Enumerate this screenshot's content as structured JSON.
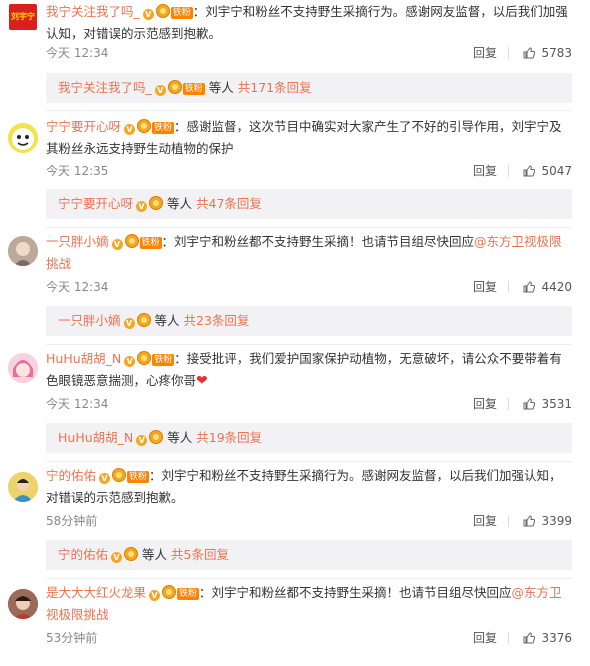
{
  "comments": [
    {
      "username": "我宁关注我了吗_",
      "fan_badge": "铁粉",
      "text": "：刘宇宁和粉丝不支持野生采摘行为。感谢网友监督，以后我们加强认知，对错误的示范感到抱歉。",
      "time": "今天 12:34",
      "reply_label": "回复",
      "likes": "5783",
      "reply_summary": {
        "username": "我宁关注我了吗_",
        "deng": "等人",
        "count_text": "共171条回复"
      },
      "avatar_text": "刘宇宁"
    },
    {
      "username": "宁宁要开心呀",
      "fan_badge": "铁粉",
      "text": "：感谢监督，这次节目中确实对大家产生了不好的引导作用，刘宇宁及其粉丝永远支持野生动植物的保护",
      "time": "今天 12:35",
      "reply_label": "回复",
      "likes": "5047",
      "reply_summary": {
        "username": "宁宁要开心呀",
        "deng": "等人",
        "count_text": "共47条回复"
      }
    },
    {
      "username": "一只胖小嫡",
      "fan_badge": "铁粉",
      "text": "：刘宇宁和粉丝都不支持野生采摘！也请节目组尽快回应",
      "mention": "@东方卫视极限挑战",
      "time": "今天 12:34",
      "reply_label": "回复",
      "likes": "4420",
      "reply_summary": {
        "username": "一只胖小嫡",
        "deng": "等人",
        "count_text": "共23条回复"
      }
    },
    {
      "username": "HuHu胡胡_N",
      "fan_badge": "铁粉",
      "text": "：接受批评，我们爱护国家保护动植物，无意破坏，请公众不要带着有色眼镜恶意揣测，心疼你哥",
      "time": "今天 12:34",
      "reply_label": "回复",
      "likes": "3531",
      "reply_summary": {
        "username": "HuHu胡胡_N",
        "deng": "等人",
        "count_text": "共19条回复"
      }
    },
    {
      "username": "宁的佑佑",
      "fan_badge": "铁粉",
      "text": "：刘宇宁和粉丝不支持野生采摘行为。感谢网友监督，以后我们加强认知，对错误的示范感到抱歉。",
      "time": "58分钟前",
      "reply_label": "回复",
      "likes": "3399",
      "reply_summary": {
        "username": "宁的佑佑",
        "deng": "等人",
        "count_text": "共5条回复"
      }
    },
    {
      "username": "是大大大红火龙果",
      "fan_badge": "铁粉",
      "text": "：刘宇宁和粉丝都不支持野生采摘！也请节目组尽快回应",
      "mention": "@东方卫视极限挑战",
      "time": "53分钟前",
      "reply_label": "回复",
      "likes": "3376"
    }
  ],
  "colors": {
    "username": "#eb7350",
    "badge": "#ff8200",
    "reply_bg": "#f2f2f5"
  }
}
